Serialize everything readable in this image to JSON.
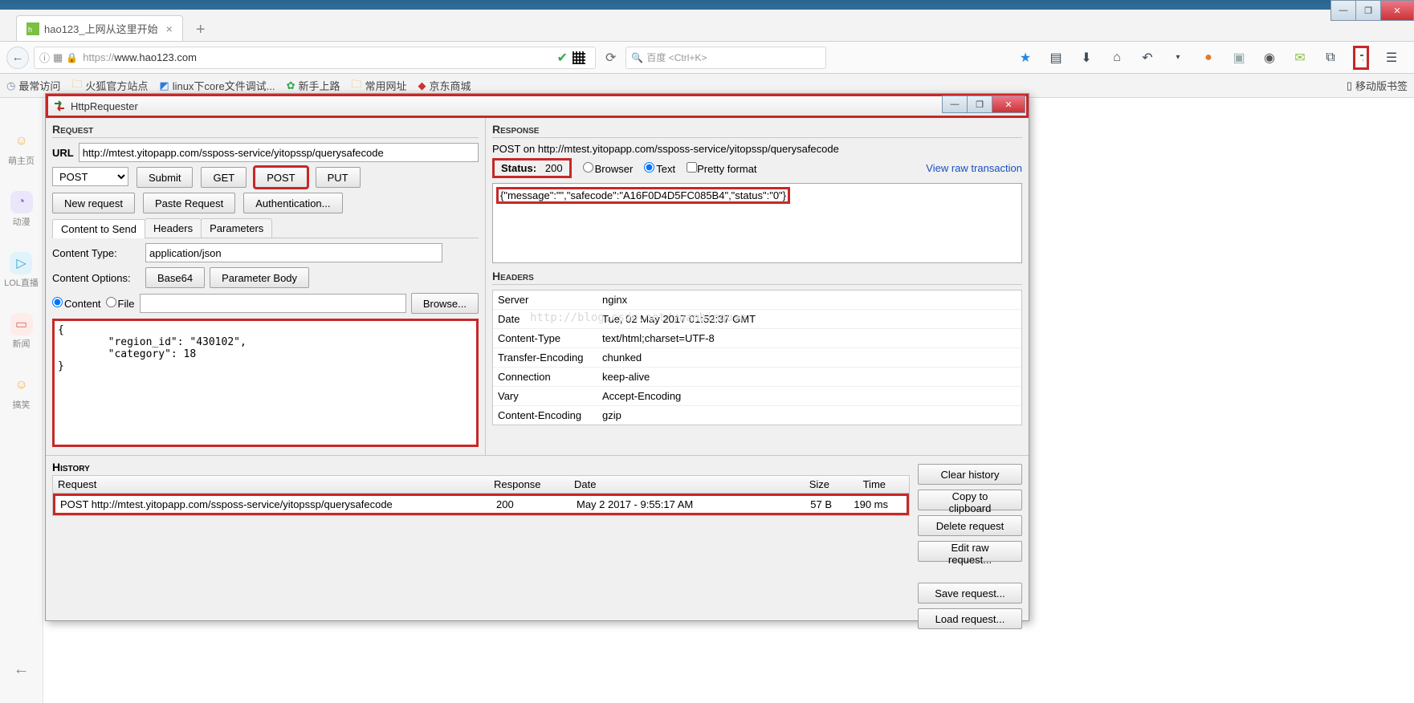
{
  "os": {
    "min": "—",
    "max": "❐",
    "close": "✕"
  },
  "browser": {
    "tab_title": "hao123_上网从这里开始",
    "url_prefix": "https://",
    "url_host": "www.hao123.com",
    "search_placeholder": "百度  <Ctrl+K>",
    "bookmarks": {
      "most": "最常访问",
      "fox": "火狐官方站点",
      "linux": "linux下core文件调试...",
      "newbie": "新手上路",
      "common": "常用网址",
      "jd": "京东商城",
      "mobile": "移动版书签"
    }
  },
  "sidebar": {
    "items": [
      {
        "label": "萌主页",
        "color": "#f4b35a"
      },
      {
        "label": "动漫",
        "color": "#b9a7e4"
      },
      {
        "label": "LOL直播",
        "color": "#57b7dc"
      },
      {
        "label": "新闻",
        "color": "#ef8e88"
      },
      {
        "label": "搞笑",
        "color": "#f2b04d"
      }
    ]
  },
  "hr": {
    "title": "HttpRequester",
    "request": {
      "head": "Request",
      "url_label": "URL",
      "url_value": "http://mtest.yitopapp.com/ssposs-service/yitopssp/querysafecode",
      "method": "POST",
      "btn_submit": "Submit",
      "btn_get": "GET",
      "btn_post": "POST",
      "btn_put": "PUT",
      "btn_new": "New request",
      "btn_paste": "Paste Request",
      "btn_auth": "Authentication...",
      "tabs": {
        "content": "Content to Send",
        "headers": "Headers",
        "params": "Parameters"
      },
      "ct_label": "Content Type:",
      "ct_value": "application/json",
      "co_label": "Content Options:",
      "btn_b64": "Base64",
      "btn_pb": "Parameter Body",
      "radio_content": "Content",
      "radio_file": "File",
      "btn_browse": "Browse...",
      "body": "{\n        \"region_id\": \"430102\",\n        \"category\": 18\n}"
    },
    "response": {
      "head": "Response",
      "topline": "POST on http://mtest.yitopapp.com/ssposs-service/yitopssp/querysafecode",
      "status_label": "Status:",
      "status_code": "200",
      "rb_browser": "Browser",
      "rb_text": "Text",
      "cb_pretty": "Pretty format",
      "viewraw": "View raw transaction",
      "body": "{\"message\":\"\",\"safecode\":\"A16F0D4D5FC085B4\",\"status\":\"0\"}",
      "headers_head": "Headers",
      "headers": [
        {
          "k": "Server",
          "v": "nginx"
        },
        {
          "k": "Date",
          "v": "Tue, 02 May 2017 01:52:37 GMT"
        },
        {
          "k": "Content-Type",
          "v": "text/html;charset=UTF-8"
        },
        {
          "k": "Transfer-Encoding",
          "v": "chunked"
        },
        {
          "k": "Connection",
          "v": "keep-alive"
        },
        {
          "k": "Vary",
          "v": "Accept-Encoding"
        },
        {
          "k": "Content-Encoding",
          "v": "gzip"
        }
      ]
    },
    "history": {
      "head": "History",
      "cols": {
        "req": "Request",
        "resp": "Response",
        "date": "Date",
        "size": "Size",
        "time": "Time"
      },
      "row": {
        "req": "POST http://mtest.yitopapp.com/ssposs-service/yitopssp/querysafecode",
        "resp": "200",
        "date": "May 2 2017 - 9:55:17 AM",
        "size": "57 B",
        "time": "190 ms"
      },
      "btns": {
        "clear": "Clear history",
        "copy": "Copy to clipboard",
        "del": "Delete request",
        "edit": "Edit raw request...",
        "save": "Save request...",
        "load": "Load request..."
      }
    }
  },
  "watermark": "http://blog.csdn.net/yuanbinquan"
}
